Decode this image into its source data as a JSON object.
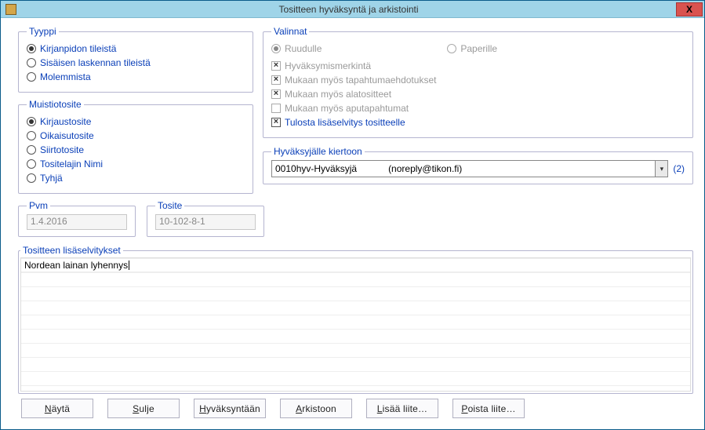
{
  "window": {
    "title": "Tositteen hyväksyntä ja arkistointi",
    "close_glyph": "X"
  },
  "tyyppi": {
    "legend": "Tyyppi",
    "opt1": "Kirjanpidon tileistä",
    "opt2": "Sisäisen laskennan tileistä",
    "opt3": "Molemmista",
    "selected": 0
  },
  "muistiotosite": {
    "legend": "Muistiotosite",
    "opt1": "Kirjaustosite",
    "opt2": "Oikaisutosite",
    "opt3": "Siirtotosite",
    "opt4": "Tositelajin Nimi",
    "opt5": "Tyhjä",
    "selected": 0
  },
  "valinnat": {
    "legend": "Valinnat",
    "ruudulle": "Ruudulle",
    "paperille": "Paperille",
    "chk1": "Hyväksymismerkintä",
    "chk2": "Mukaan myös tapahtumaehdotukset",
    "chk3": "Mukaan myös alatositteet",
    "chk4": "Mukaan myös aputapahtumat",
    "chk5": "Tulosta lisäselvitys tositteelle"
  },
  "approver": {
    "legend": "Hyväksyjälle kiertoon",
    "value_code": "0010hyv",
    "value_sep": " - ",
    "value_name": "Hyväksyjä",
    "value_email": "(noreply@tikon.fi)",
    "count": "(2)"
  },
  "pvm": {
    "legend": "Pvm",
    "value": "1.4.2016"
  },
  "tosite": {
    "legend": "Tosite",
    "value": "10-102-8-1"
  },
  "notes": {
    "legend": "Tositteen lisäselvitykset",
    "line0": "Nordean lainan lyhennys"
  },
  "buttons": {
    "nayta": {
      "pre": "",
      "u": "N",
      "post": "äytä"
    },
    "sulje": {
      "pre": "",
      "u": "S",
      "post": "ulje"
    },
    "hyvaksyntaan": {
      "pre": "",
      "u": "H",
      "post": "yväksyntään"
    },
    "arkistoon": {
      "pre": "",
      "u": "A",
      "post": "rkistoon"
    },
    "lisaa": {
      "pre": "",
      "u": "L",
      "post": "isää liite…"
    },
    "poista": {
      "pre": "",
      "u": "P",
      "post": "oista liite…"
    }
  }
}
